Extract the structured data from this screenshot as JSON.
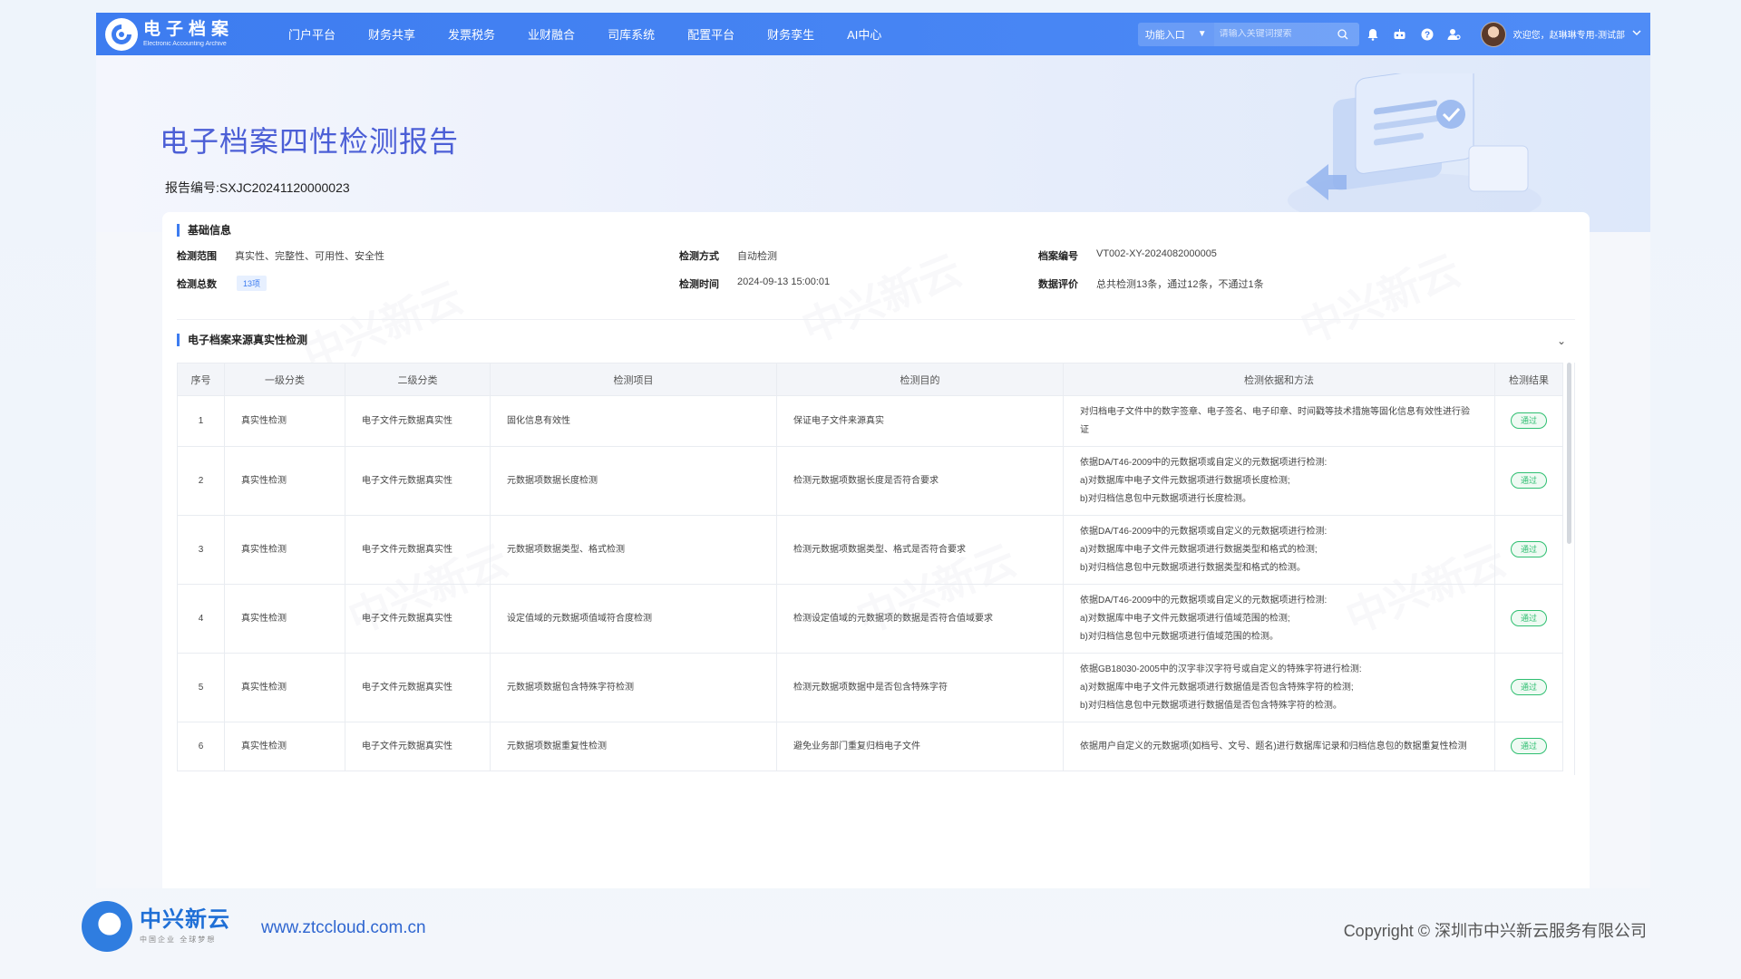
{
  "header": {
    "logo_cn": "电子档案",
    "logo_en": "Electronic Accounting Archive",
    "nav": [
      "门户平台",
      "财务共享",
      "发票税务",
      "业财融合",
      "司库系统",
      "配置平台",
      "财务孪生",
      "AI中心"
    ],
    "portal_label": "功能入口",
    "search_placeholder": "请输入关键词搜索",
    "user_greeting": "欢迎您，赵琳琳专用-测试部"
  },
  "hero": {
    "title": "电子档案四性检测报告",
    "report_no": "报告编号:SXJC20241120000023"
  },
  "basic_info": {
    "section_title": "基础信息",
    "scope_label": "检测范围",
    "scope_value": "真实性、完整性、可用性、安全性",
    "method_label": "检测方式",
    "method_value": "自动检测",
    "archive_no_label": "档案编号",
    "archive_no_value": "VT002-XY-2024082000005",
    "total_label": "检测总数",
    "total_value": "13项",
    "time_label": "检测时间",
    "time_value": "2024-09-13 15:00:01",
    "eval_label": "数据评价",
    "eval_value": "总共检测13条，通过12条，不通过1条"
  },
  "detection": {
    "section_title": "电子档案来源真实性检测",
    "columns": [
      "序号",
      "一级分类",
      "二级分类",
      "检测项目",
      "检测目的",
      "检测依据和方法",
      "检测结果"
    ],
    "rows": [
      {
        "no": "1",
        "level1": "真实性检测",
        "level2": "电子文件元数据真实性",
        "item": "固化信息有效性",
        "purpose": "保证电子文件来源真实",
        "basis": [
          "对归档电子文件中的数字签章、电子签名、电子印章、时间戳等技术措施等固化信息有效性进行验证"
        ],
        "result": "通过"
      },
      {
        "no": "2",
        "level1": "真实性检测",
        "level2": "电子文件元数据真实性",
        "item": "元数据项数据长度检测",
        "purpose": "检测元数据项数据长度是否符合要求",
        "basis": [
          "依据DA/T46-2009中的元数据项或自定义的元数据项进行检测:",
          "a)对数据库中电子文件元数据项进行数据项长度检测;",
          "b)对归档信息包中元数据项进行长度检测。"
        ],
        "result": "通过"
      },
      {
        "no": "3",
        "level1": "真实性检测",
        "level2": "电子文件元数据真实性",
        "item": "元数据项数据类型、格式检测",
        "purpose": "检测元数据项数据类型、格式是否符合要求",
        "basis": [
          "依据DA/T46-2009中的元数据项或自定义的元数据项进行检测:",
          "a)对数据库中电子文件元数据项进行数据类型和格式的检测;",
          "b)对归档信息包中元数据项进行数据类型和格式的检测。"
        ],
        "result": "通过"
      },
      {
        "no": "4",
        "level1": "真实性检测",
        "level2": "电子文件元数据真实性",
        "item": "设定值域的元数据项值域符合度检测",
        "purpose": "检测设定值域的元数据项的数据是否符合值域要求",
        "basis": [
          "依据DA/T46-2009中的元数据项或自定义的元数据项进行检测:",
          "a)对数据库中电子文件元数据项进行值域范围的检测;",
          "b)对归档信息包中元数据项进行值域范围的检测。"
        ],
        "result": "通过"
      },
      {
        "no": "5",
        "level1": "真实性检测",
        "level2": "电子文件元数据真实性",
        "item": "元数据项数据包含特殊字符检测",
        "purpose": "检测元数据项数据中是否包含特殊字符",
        "basis": [
          "依据GB18030-2005中的汉字非汉字符号或自定义的特殊字符进行检测:",
          "a)对数据库中电子文件元数据项进行数据值是否包含特殊字符的检测;",
          "b)对归档信息包中元数据项进行数据值是否包含特殊字符的检测。"
        ],
        "result": "通过"
      },
      {
        "no": "6",
        "level1": "真实性检测",
        "level2": "电子文件元数据真实性",
        "item": "元数据项数据重复性检测",
        "purpose": "避免业务部门重复归档电子文件",
        "basis": [
          "依据用户自定义的元数据项(如档号、文号、题名)进行数据库记录和归档信息包的数据重复性检测"
        ],
        "result": "通过"
      }
    ]
  },
  "footer": {
    "brand_cn": "中兴新云",
    "brand_sub": "中国企业 全球梦想",
    "url": "www.ztccloud.com.cn",
    "copyright": "Copyright © 深圳市中兴新云服务有限公司"
  },
  "colors": {
    "primary": "#3d7cf0",
    "pass": "#2fbf71",
    "title": "#4c5fd6"
  }
}
